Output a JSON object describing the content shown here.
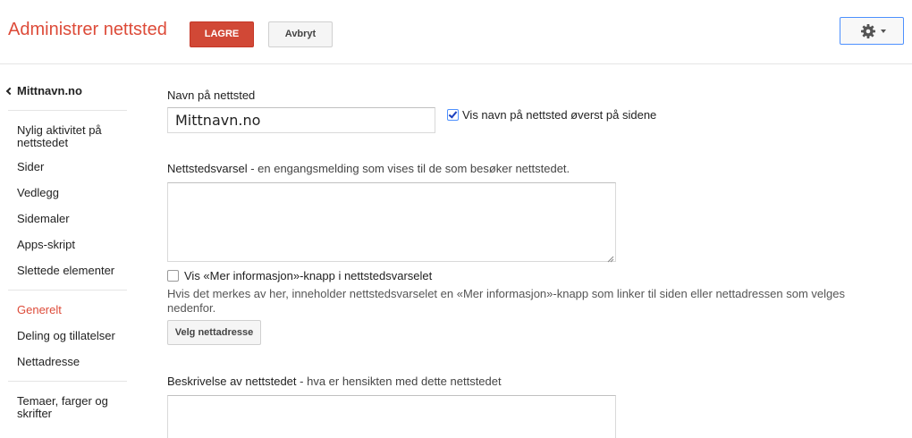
{
  "header": {
    "title": "Administrer nettsted",
    "save_label": "LAGRE",
    "cancel_label": "Avbryt",
    "settings_icon": "gear-icon"
  },
  "sidebar": {
    "back_label": "Mittnavn.no",
    "items": [
      {
        "label": "Nylig aktivitet på nettstedet"
      },
      {
        "label": "Sider"
      },
      {
        "label": "Vedlegg"
      },
      {
        "label": "Sidemaler"
      },
      {
        "label": "Apps-skript"
      },
      {
        "label": "Slettede elementer"
      },
      {
        "label": "Generelt",
        "active": true
      },
      {
        "label": "Deling og tillatelser"
      },
      {
        "label": "Nettadresse"
      },
      {
        "label": "Temaer, farger og skrifter"
      }
    ]
  },
  "main": {
    "site_name_label": "Navn på nettsted",
    "site_name_value": "Mittnavn.no",
    "show_name_checkbox": {
      "label": "Vis navn på nettsted øverst på sidene",
      "checked": true
    },
    "notice_label": "Nettstedsvarsel",
    "notice_hint": " - en engangsmelding som vises til de som besøker nettstedet.",
    "notice_value": "",
    "more_info_checkbox": {
      "label": "Vis «Mer informasjon»-knapp i nettstedsvarselet",
      "checked": false
    },
    "more_info_help": "Hvis det merkes av her, inneholder nettstedsvarselet en «Mer informasjon»-knapp som linker til siden eller nettadressen som velges nedenfor.",
    "choose_url_label": "Velg nettadresse",
    "description_label": "Beskrivelse av nettstedet",
    "description_hint": " - hva er hensikten med dette nettstedet",
    "description_value": ""
  },
  "colors": {
    "accent": "#dd4b39",
    "save_button": "#d14836",
    "focus_border": "#4d90fe"
  }
}
